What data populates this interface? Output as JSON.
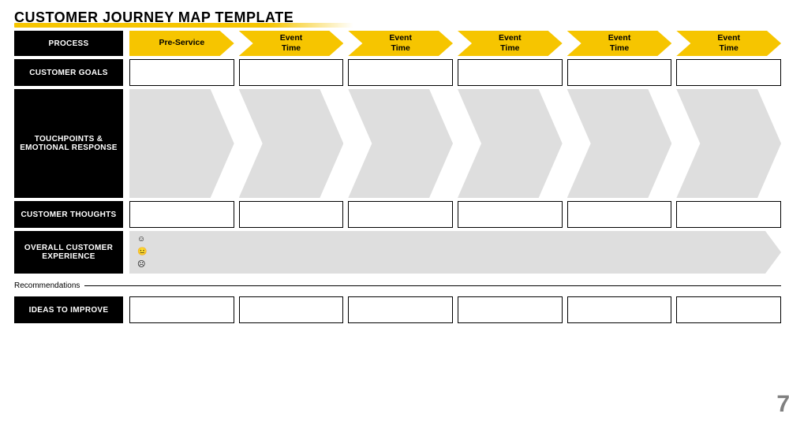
{
  "title": "CUSTOMER JOURNEY MAP TEMPLATE",
  "rows": {
    "process": {
      "label": "PROCESS",
      "stages": [
        "Pre-Service",
        "Event\nTime",
        "Event\nTime",
        "Event\nTime",
        "Event\nTime",
        "Event\nTime"
      ]
    },
    "goals": {
      "label": "CUSTOMER GOALS",
      "cells": [
        "",
        "",
        "",
        "",
        "",
        ""
      ]
    },
    "touchpoints": {
      "label": "TOUCHPOINTS & EMOTIONAL RESPONSE",
      "cells": [
        "",
        "",
        "",
        "",
        "",
        ""
      ]
    },
    "thoughts": {
      "label": "CUSTOMER THOUGHTS",
      "cells": [
        "",
        "",
        "",
        "",
        "",
        ""
      ]
    },
    "experience": {
      "label": "OVERALL CUSTOMER EXPERIENCE",
      "emojis": [
        "☺",
        "😐",
        "☹"
      ]
    },
    "ideas": {
      "label": "IDEAS TO IMPROVE",
      "cells": [
        "",
        "",
        "",
        "",
        "",
        ""
      ]
    }
  },
  "recommendations_label": "Recommendations",
  "page_number": "7"
}
